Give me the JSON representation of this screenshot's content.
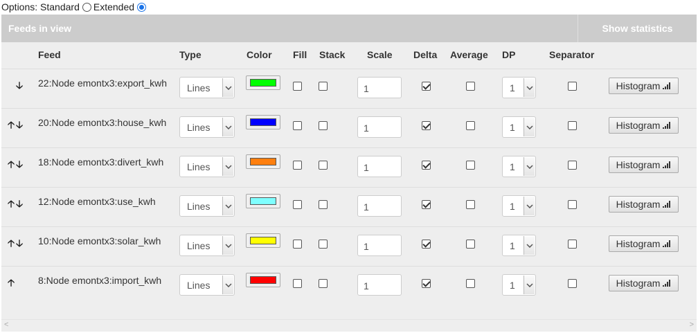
{
  "options": {
    "label": "Options:",
    "standard_label": "Standard",
    "extended_label": "Extended",
    "selected": "Extended"
  },
  "panel": {
    "title": "Feeds in view",
    "stats_button": "Show statistics"
  },
  "columns": {
    "feed": "Feed",
    "type": "Type",
    "color": "Color",
    "fill": "Fill",
    "stack": "Stack",
    "scale": "Scale",
    "delta": "Delta",
    "average": "Average",
    "dp": "DP",
    "separator": "Separator"
  },
  "rows": [
    {
      "arrows": "down",
      "name": "22:Node emontx3:export_kwh",
      "type": "Lines",
      "color": "#00ff00",
      "fill": false,
      "stack": false,
      "scale": "1",
      "delta": true,
      "average": false,
      "dp": "1",
      "separator": false,
      "button": "Histogram"
    },
    {
      "arrows": "both",
      "name": "20:Node emontx3:house_kwh",
      "type": "Lines",
      "color": "#0000ff",
      "fill": false,
      "stack": false,
      "scale": "1",
      "delta": true,
      "average": false,
      "dp": "1",
      "separator": false,
      "button": "Histogram"
    },
    {
      "arrows": "both",
      "name": "18:Node emontx3:divert_kwh",
      "type": "Lines",
      "color": "#ff7f0e",
      "fill": false,
      "stack": false,
      "scale": "1",
      "delta": true,
      "average": false,
      "dp": "1",
      "separator": false,
      "button": "Histogram"
    },
    {
      "arrows": "both",
      "name": "12:Node emontx3:use_kwh",
      "type": "Lines",
      "color": "#7fffff",
      "fill": false,
      "stack": false,
      "scale": "1",
      "delta": true,
      "average": false,
      "dp": "1",
      "separator": false,
      "button": "Histogram"
    },
    {
      "arrows": "both",
      "name": "10:Node emontx3:solar_kwh",
      "type": "Lines",
      "color": "#ffff00",
      "fill": false,
      "stack": false,
      "scale": "1",
      "delta": true,
      "average": false,
      "dp": "1",
      "separator": false,
      "button": "Histogram"
    },
    {
      "arrows": "up",
      "name": "8:Node emontx3:import_kwh",
      "type": "Lines",
      "color": "#ff0000",
      "fill": false,
      "stack": false,
      "scale": "1",
      "delta": true,
      "average": false,
      "dp": "1",
      "separator": false,
      "button": "Histogram"
    }
  ],
  "icons": {
    "up": "up-arrow-icon",
    "down": "down-arrow-icon",
    "select": "chevron-down-icon",
    "histogram": "bar-chart-icon",
    "scroll_left": "scroll-left-icon",
    "scroll_right": "scroll-right-icon"
  }
}
